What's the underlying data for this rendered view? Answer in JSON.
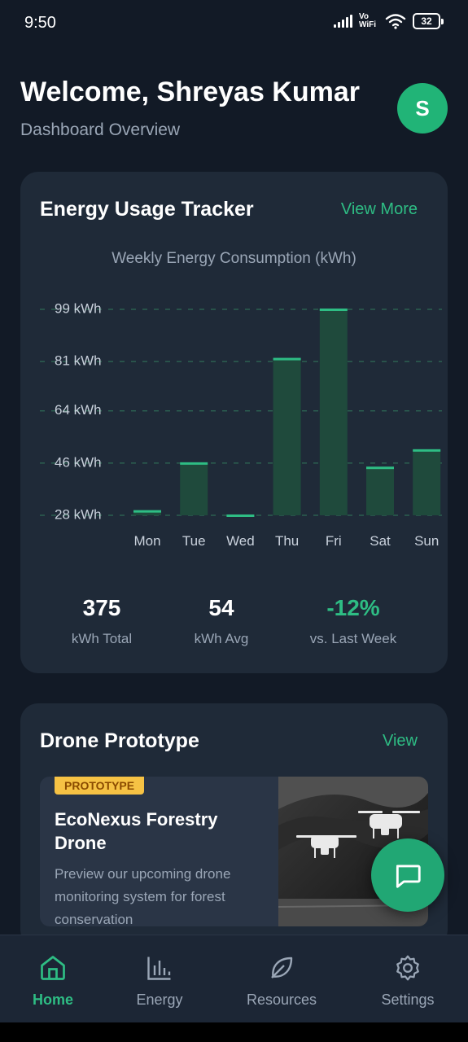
{
  "status_bar": {
    "time": "9:50",
    "network_label": "Vo WiFi",
    "battery": "32"
  },
  "header": {
    "welcome": "Welcome, Shreyas Kumar",
    "subtitle": "Dashboard Overview",
    "avatar_initial": "S"
  },
  "energy_card": {
    "title": "Energy Usage Tracker",
    "link": "View More",
    "chart_title": "Weekly Energy Consumption (kWh)",
    "stats": [
      {
        "value": "375",
        "label": "kWh Total"
      },
      {
        "value": "54",
        "label": "kWh Avg"
      },
      {
        "value": "-12%",
        "label": "vs. Last Week"
      }
    ]
  },
  "chart_data": {
    "type": "bar",
    "title": "Weekly Energy Consumption (kWh)",
    "categories": [
      "Mon",
      "Tue",
      "Wed",
      "Thu",
      "Fri",
      "Sat",
      "Sun"
    ],
    "values": [
      29.5,
      46,
      28,
      82,
      99,
      44.5,
      50.5
    ],
    "y_ticks": [
      28,
      46,
      64,
      81,
      99
    ],
    "y_tick_labels": [
      "28 kWh",
      "46 kWh",
      "64 kWh",
      "81 kWh",
      "99 kWh"
    ],
    "ylim": [
      28,
      99
    ],
    "grid": true,
    "colors": {
      "bar_fill": "#1f4a3c",
      "bar_top": "#2ebd84",
      "grid": "#2f6b55"
    }
  },
  "drone_card": {
    "title": "Drone Prototype",
    "link": "View",
    "badge": "PROTOTYPE",
    "item_title": "EcoNexus Forestry Drone",
    "item_desc": "Preview our upcoming drone monitoring system for forest conservation"
  },
  "fab": {
    "icon": "chat-bubble-icon"
  },
  "nav": [
    {
      "label": "Home",
      "icon": "home-icon",
      "active": true
    },
    {
      "label": "Energy",
      "icon": "bar-chart-icon",
      "active": false
    },
    {
      "label": "Resources",
      "icon": "leaf-icon",
      "active": false
    },
    {
      "label": "Settings",
      "icon": "gear-icon",
      "active": false
    }
  ],
  "colors": {
    "background": "#121a26",
    "card": "#1f2a38",
    "accent": "#2ebd84",
    "avatar": "#21b477",
    "badge": "#f6c244"
  }
}
